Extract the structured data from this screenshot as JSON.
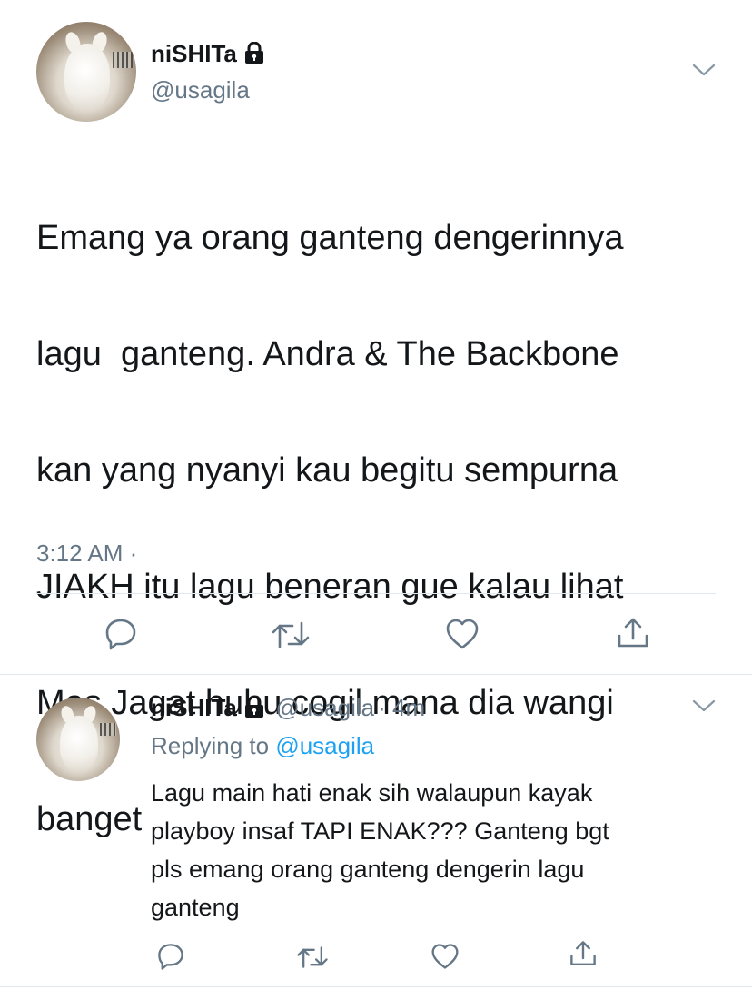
{
  "main_tweet": {
    "name": "niSHITa",
    "handle": "@usagila",
    "text_lines": [
      "Emang ya orang ganteng dengerinnya",
      "lagu  ganteng. Andra & The Backbone",
      "kan yang nyanyi kau begitu sempurna",
      "JIAKH itu lagu beneran gue kalau lihat",
      "Mas Jagat huhu cogil mana dia wangi",
      "banget"
    ],
    "time": "3:12 AM ·"
  },
  "reply_tweet": {
    "name": "niSHITa",
    "handle": "@usagila",
    "age": "· 4m",
    "replying_prefix": "Replying to",
    "replying_handle": "@usagila",
    "text_lines": [
      "Lagu main hati enak sih walaupun kayak",
      "playboy insaf TAPI ENAK??? Ganteng bgt",
      "pls emang orang ganteng dengerin lagu",
      "ganteng"
    ]
  },
  "icons": {
    "lock": "lock-icon",
    "more": "chevron-down-icon",
    "reply": "reply-icon",
    "retweet": "retweet-icon",
    "like": "heart-icon",
    "share": "share-icon"
  },
  "colors": {
    "text": "#14171a",
    "secondary": "#657786",
    "link": "#1da1f2",
    "divider": "#e1e8ed"
  }
}
